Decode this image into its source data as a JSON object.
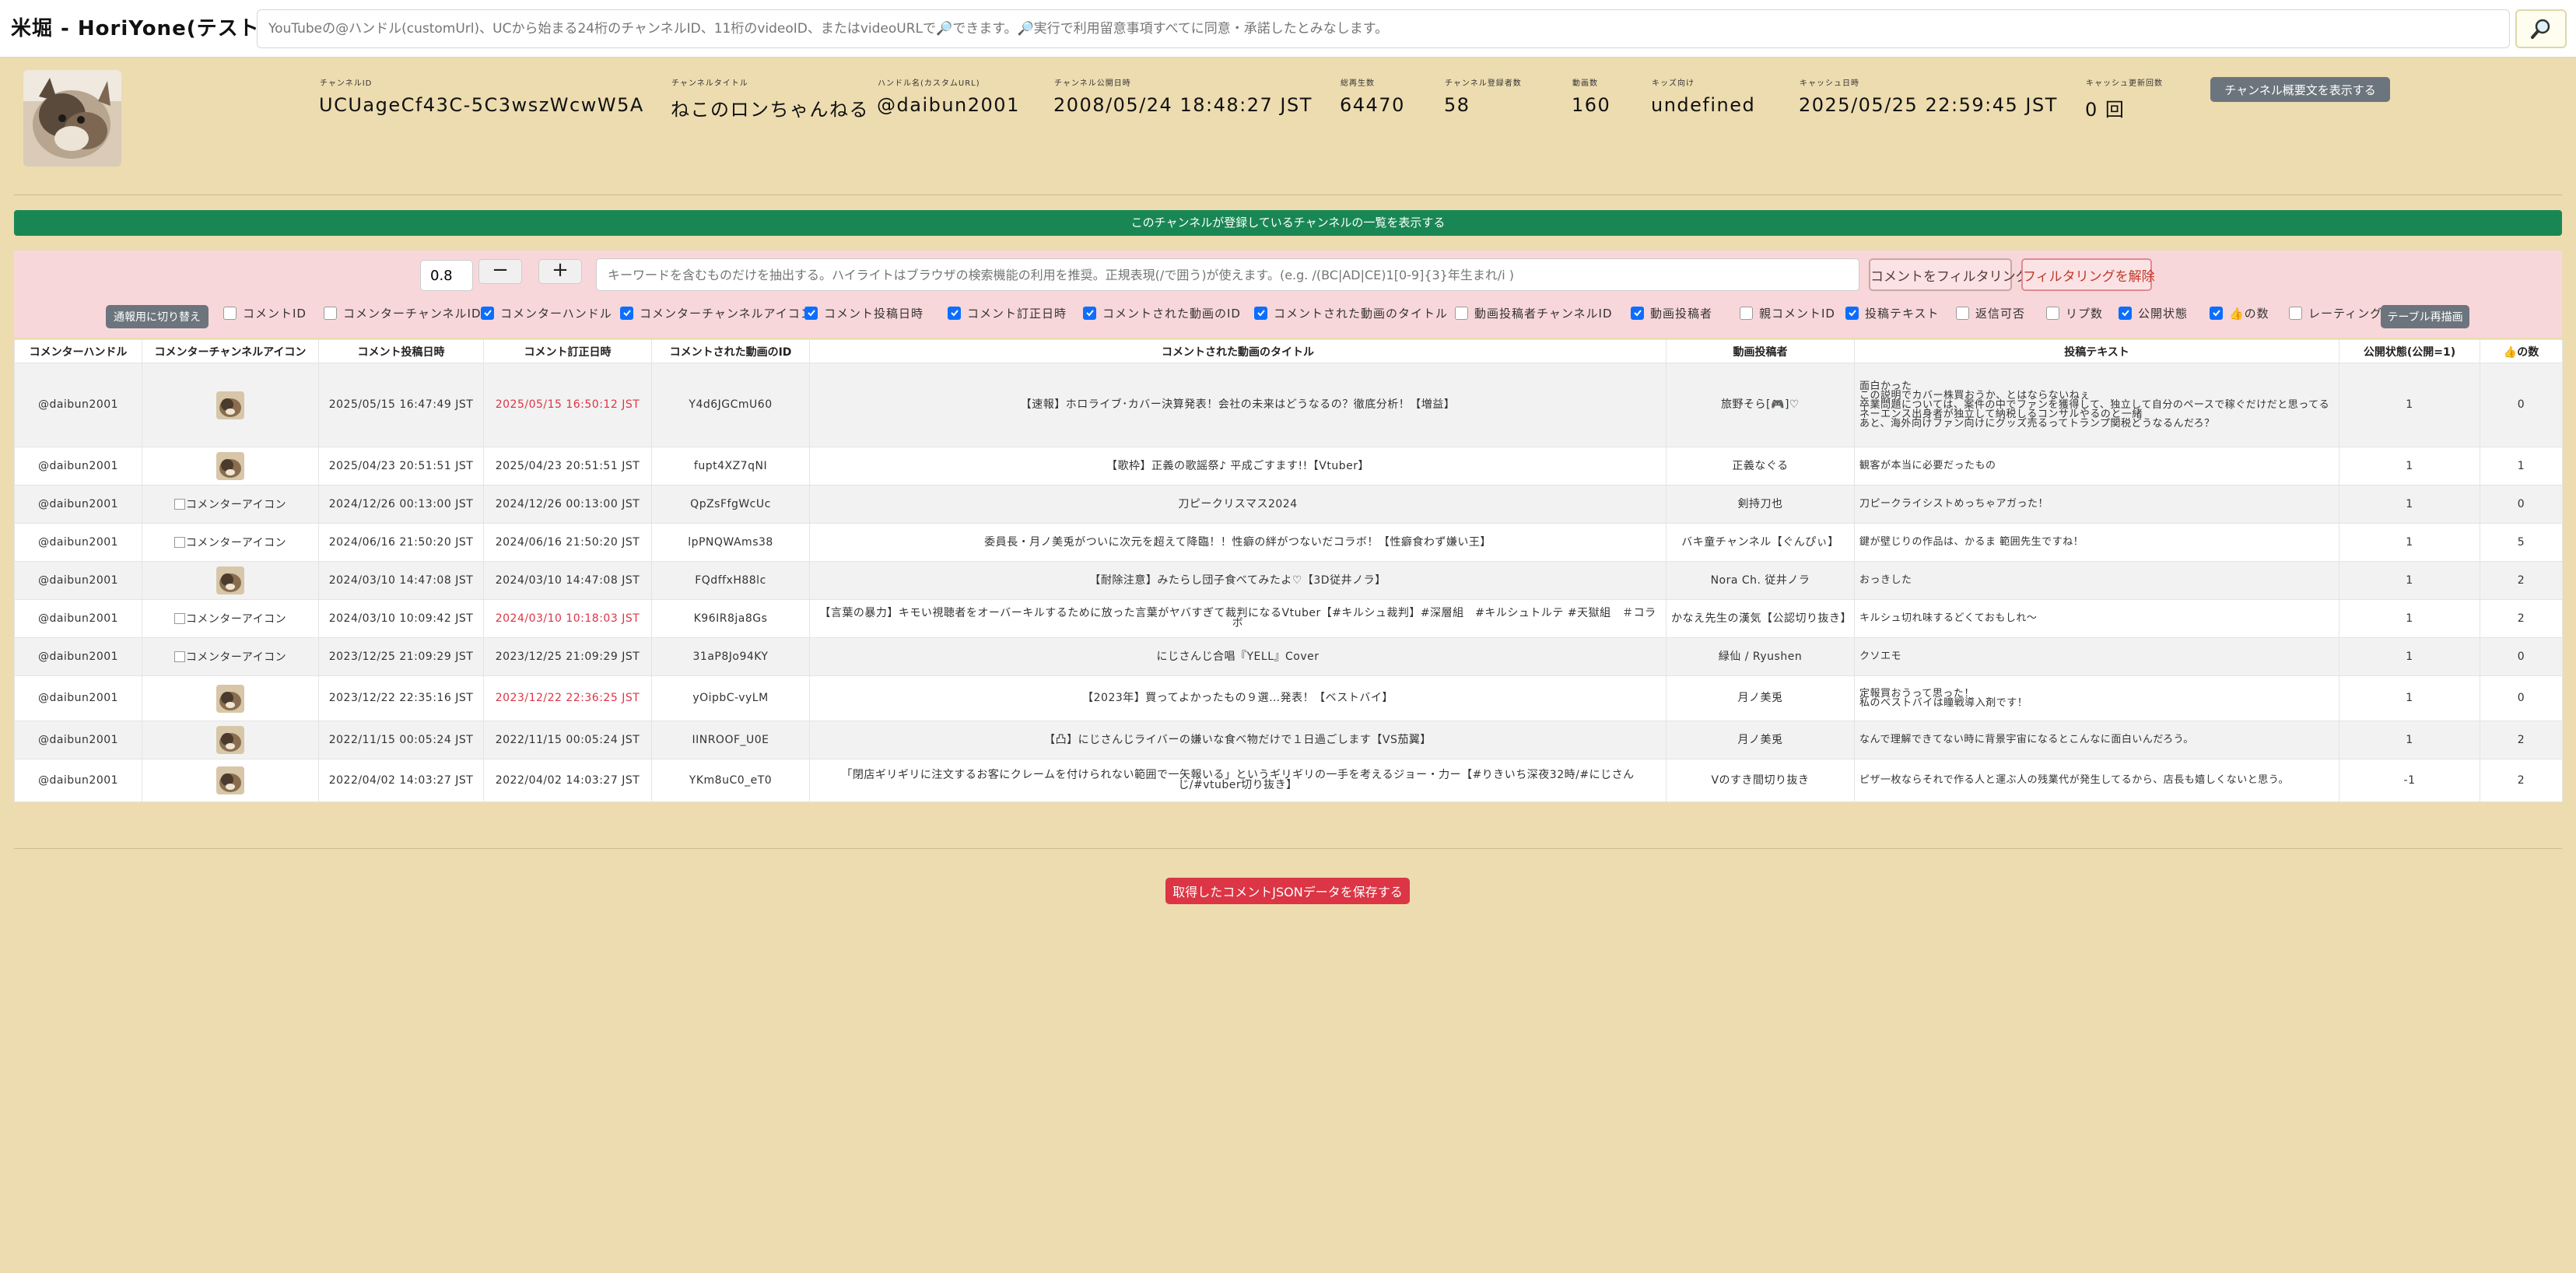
{
  "app": {
    "title": "米堀 - HoriYone(テスト中)"
  },
  "search": {
    "placeholder": "YouTubeの@ハンドル(customUrl)、UCから始まる24桁のチャンネルID、11桁のvideoID、またはvideoURLで🔎できます。🔎実行で利用留意事項すべてに同意・承諾したとみなします。",
    "button_icon": "magnifier-icon"
  },
  "channel": {
    "fields": [
      {
        "label": "チャンネルID",
        "value": "UCUageCf43C-5C3wszWcwW5A"
      },
      {
        "label": "チャンネルタイトル",
        "value": "ねこのロンちゃんねる"
      },
      {
        "label": "ハンドル名(カスタムURL)",
        "value": "@daibun2001"
      },
      {
        "label": "チャンネル公開日時",
        "value": "2008/05/24 18:48:27 JST"
      },
      {
        "label": "総再生数",
        "value": "64470"
      },
      {
        "label": "チャンネル登録者数",
        "value": "58"
      },
      {
        "label": "動画数",
        "value": "160"
      },
      {
        "label": "キッズ向け",
        "value": "undefined"
      },
      {
        "label": "キャッシュ日時",
        "value": "2025/05/25 22:59:45 JST"
      },
      {
        "label": "キャッシュ更新回数",
        "value": "0 回"
      }
    ],
    "show_description_label": "チャンネル概要文を表示する",
    "subscriptions_bar_label": "このチャンネルが登録しているチャンネルの一覧を表示する"
  },
  "filter": {
    "threshold": "0.8",
    "minus_label": "−",
    "plus_label": "+",
    "keyword_placeholder": "キーワードを含むものだけを抽出する。ハイライトはブラウザの検索機能の利用を推奨。正規表現(/で囲う)が使えます。(e.g. /(BC|AD|CE)1[0-9]{3}年生まれ/i )",
    "filter_label": "コメントをフィルタリング",
    "clear_label": "フィルタリングを解除",
    "toggle_label": "通報用に切り替え",
    "redraw_label": "テーブル再描画",
    "columns": [
      {
        "label": "コメントID",
        "checked": false
      },
      {
        "label": "コメンターチャンネルID",
        "checked": false
      },
      {
        "label": "コメンターハンドル",
        "checked": true
      },
      {
        "label": "コメンターチャンネルアイコン",
        "checked": true
      },
      {
        "label": "コメント投稿日時",
        "checked": true
      },
      {
        "label": "コメント訂正日時",
        "checked": true
      },
      {
        "label": "コメントされた動画のID",
        "checked": true
      },
      {
        "label": "コメントされた動画のタイトル",
        "checked": true
      },
      {
        "label": "動画投稿者チャンネルID",
        "checked": false
      },
      {
        "label": "動画投稿者",
        "checked": true
      },
      {
        "label": "親コメントID",
        "checked": false
      },
      {
        "label": "投稿テキスト",
        "checked": true
      },
      {
        "label": "返信可否",
        "checked": false
      },
      {
        "label": "リプ数",
        "checked": false
      },
      {
        "label": "公開状態",
        "checked": true
      },
      {
        "label": "👍の数",
        "checked": true
      },
      {
        "label": "レーティング",
        "checked": false
      }
    ]
  },
  "table": {
    "headers": [
      "コメンターハンドル",
      "コメンターチャンネルアイコン",
      "コメント投稿日時",
      "コメント訂正日時",
      "コメントされた動画のID",
      "コメントされた動画のタイトル",
      "動画投稿者",
      "投稿テキスト",
      "公開状態(公開=1)",
      "👍の数"
    ],
    "rows": [
      {
        "handle": "@daibun2001",
        "icon": "avatar",
        "posted": "2025/05/15 16:47:49 JST",
        "edited": "2025/05/15 16:50:12 JST",
        "edited_red": true,
        "video_id": "Y4d6JGCmU60",
        "title": "【速報】ホロライブ･カバー決算発表！会社の未来はどうなるの？徹底分析！【増益】",
        "uploader": "旅野そら[🎮]♡",
        "text": "面白かった\nこの説明でカバー株買おうか、とはならないねぇ\n卒業問題については、案件の中でファンを獲得して、独立して自分のペースで稼ぐだけだと思ってる\nネーエンス出身者が独立して納税しるコンサルやるのと一緒\nあと、海外向けファン向けにグッズ売るってトランプ関税どうなるんだろ？",
        "public": "1",
        "likes": "0"
      },
      {
        "handle": "@daibun2001",
        "icon": "avatar",
        "posted": "2025/04/23 20:51:51 JST",
        "edited": "2025/04/23 20:51:51 JST",
        "edited_red": false,
        "video_id": "fupt4XZ7qNI",
        "title": "【歌枠】正義の歌謡祭♪ 平成ごすます!!【Vtuber】",
        "uploader": "正義なぐる",
        "text": "観客が本当に必要だったもの",
        "public": "1",
        "likes": "1"
      },
      {
        "handle": "@daibun2001",
        "icon": "broken",
        "posted": "2024/12/26 00:13:00 JST",
        "edited": "2024/12/26 00:13:00 JST",
        "edited_red": false,
        "video_id": "QpZsFfgWcUc",
        "title": "刀ピークリスマス2024",
        "uploader": "剣持刀也",
        "text": "刀ピークライシストめっちゃアガった！",
        "public": "1",
        "likes": "0"
      },
      {
        "handle": "@daibun2001",
        "icon": "broken",
        "posted": "2024/06/16 21:50:20 JST",
        "edited": "2024/06/16 21:50:20 JST",
        "edited_red": false,
        "video_id": "lpPNQWAms38",
        "title": "委員長・月ノ美兎がついに次元を超えて降臨！！性癖の絆がつないだコラボ！【性癖食わず嫌い王】",
        "uploader": "バキ童チャンネル【ぐんぴぃ】",
        "text": "鍵が壁じりの作品は、かるま 範囲先生ですね！",
        "public": "1",
        "likes": "5"
      },
      {
        "handle": "@daibun2001",
        "icon": "avatar",
        "posted": "2024/03/10 14:47:08 JST",
        "edited": "2024/03/10 14:47:08 JST",
        "edited_red": false,
        "video_id": "FQdffxH88lc",
        "title": "【耐除注意】みたらし団子食べてみたよ♡【3D従井ノラ】",
        "uploader": "Nora Ch. 従井ノラ",
        "text": "おっきした",
        "public": "1",
        "likes": "2"
      },
      {
        "handle": "@daibun2001",
        "icon": "broken",
        "posted": "2024/03/10 10:09:42 JST",
        "edited": "2024/03/10 10:18:03 JST",
        "edited_red": true,
        "video_id": "K96IR8ja8Gs",
        "title": "【言葉の暴力】キモい視聴者をオーバーキルするために放った言葉がヤバすぎて裁判になるVtuber【#キルシュ裁判】#深層組　#キルシュトルテ #天獄組　＃コラボ",
        "uploader": "かなえ先生の漢気【公認切り抜き】",
        "text": "キルシュ切れ味するどくておもしれ～",
        "public": "1",
        "likes": "2"
      },
      {
        "handle": "@daibun2001",
        "icon": "broken",
        "posted": "2023/12/25 21:09:29 JST",
        "edited": "2023/12/25 21:09:29 JST",
        "edited_red": false,
        "video_id": "31aP8Jo94KY",
        "title": "にじさんじ合唱『YELL』Cover",
        "uploader": "緑仙 / Ryushen",
        "text": "クソエモ",
        "public": "1",
        "likes": "0"
      },
      {
        "handle": "@daibun2001",
        "icon": "avatar",
        "posted": "2023/12/22 22:35:16 JST",
        "edited": "2023/12/22 22:36:25 JST",
        "edited_red": true,
        "video_id": "yOipbC-vyLM",
        "title": "【2023年】買ってよかったもの９選…発表！【ベストバイ】",
        "uploader": "月ノ美兎",
        "text": "定報買おうって思った！\n私のベストバイは瞳戦導入剤です！",
        "public": "1",
        "likes": "0"
      },
      {
        "handle": "@daibun2001",
        "icon": "avatar",
        "posted": "2022/11/15 00:05:24 JST",
        "edited": "2022/11/15 00:05:24 JST",
        "edited_red": false,
        "video_id": "IINROOF_U0E",
        "title": "【凸】にじさんじライバーの嫌いな食べ物だけで１日過ごします【VS茄翼】",
        "uploader": "月ノ美兎",
        "text": "なんで理解できてない時に背景宇宙になるとこんなに面白いんだろう。",
        "public": "1",
        "likes": "2"
      },
      {
        "handle": "@daibun2001",
        "icon": "avatar",
        "posted": "2022/04/02 14:03:27 JST",
        "edited": "2022/04/02 14:03:27 JST",
        "edited_red": false,
        "video_id": "YKm8uC0_eT0",
        "title": "「閉店ギリギリに注文するお客にクレームを付けられない範囲で一矢報いる」というギリギリの一手を考えるジョー・力ー【#りきいち深夜32時/#にじさんじ/#vtuber切り抜き】",
        "uploader": "Vのすき間切り抜き",
        "text": "ピザ一枚ならそれで作る人と運ぶ人の残業代が発生してるから、店長も嬉しくないと思う。",
        "public": "-1",
        "likes": "2"
      }
    ],
    "broken_icon_alt": "コメンターアイコン"
  },
  "save_label": "取得したコメントJSONデータを保存する"
}
